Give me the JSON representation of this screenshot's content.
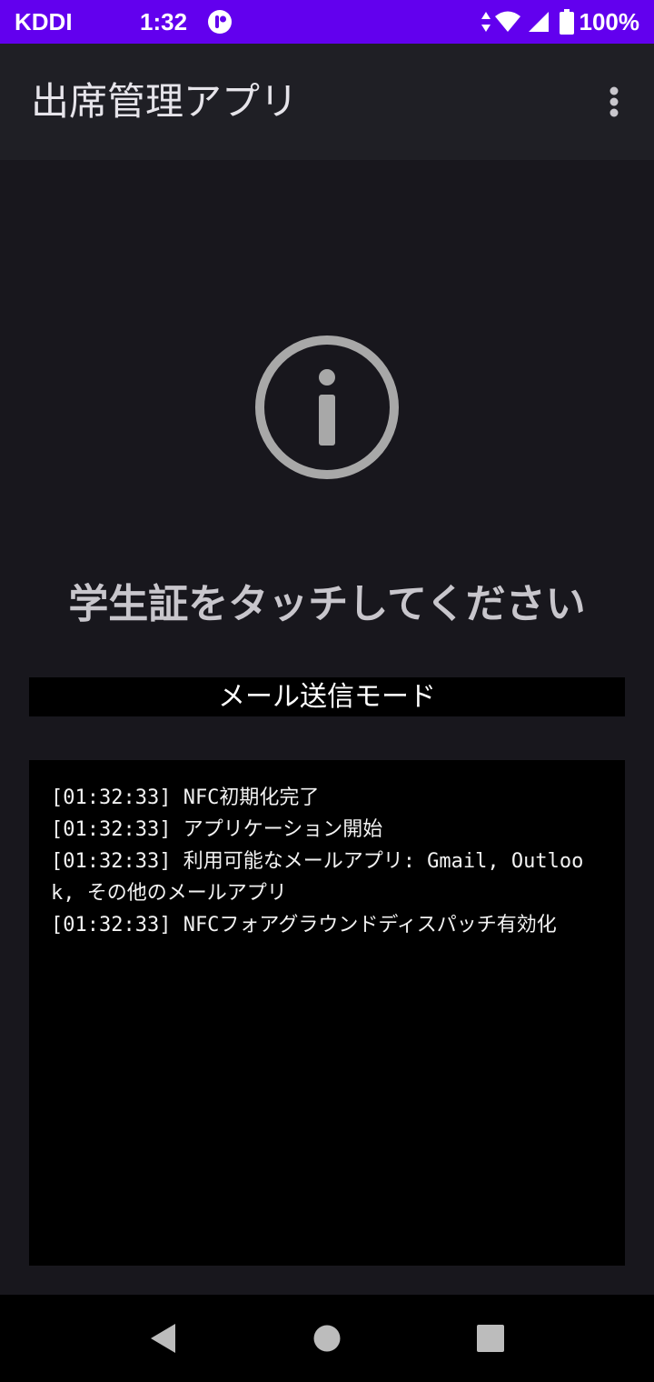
{
  "status_bar": {
    "carrier": "KDDI",
    "time": "1:32",
    "battery": "100%",
    "background": "#6200ee",
    "icons": [
      "notification-app-icon",
      "data-arrows-icon",
      "wifi-icon",
      "signal-icon",
      "battery-icon"
    ]
  },
  "app_bar": {
    "title": "出席管理アプリ",
    "menu_icon": "more-vert-icon"
  },
  "main": {
    "status_icon": "info-circle-icon",
    "prompt": "学生証をタッチしてください",
    "mode_label": "メール送信モード",
    "log_lines": [
      "[01:32:33] NFC初期化完了",
      "[01:32:33] アプリケーション開始",
      "[01:32:33] 利用可能なメールアプリ: Gmail, Outlook, その他のメールアプリ",
      "[01:32:33] NFCフォアグラウンドディスパッチ有効化"
    ]
  },
  "nav_bar": {
    "icons": [
      "back-icon",
      "home-icon",
      "recents-icon"
    ]
  },
  "colors": {
    "background": "#18171d",
    "app_bar": "#1f1f25",
    "panel": "#000000",
    "prompt_text": "#c8c6cc"
  }
}
